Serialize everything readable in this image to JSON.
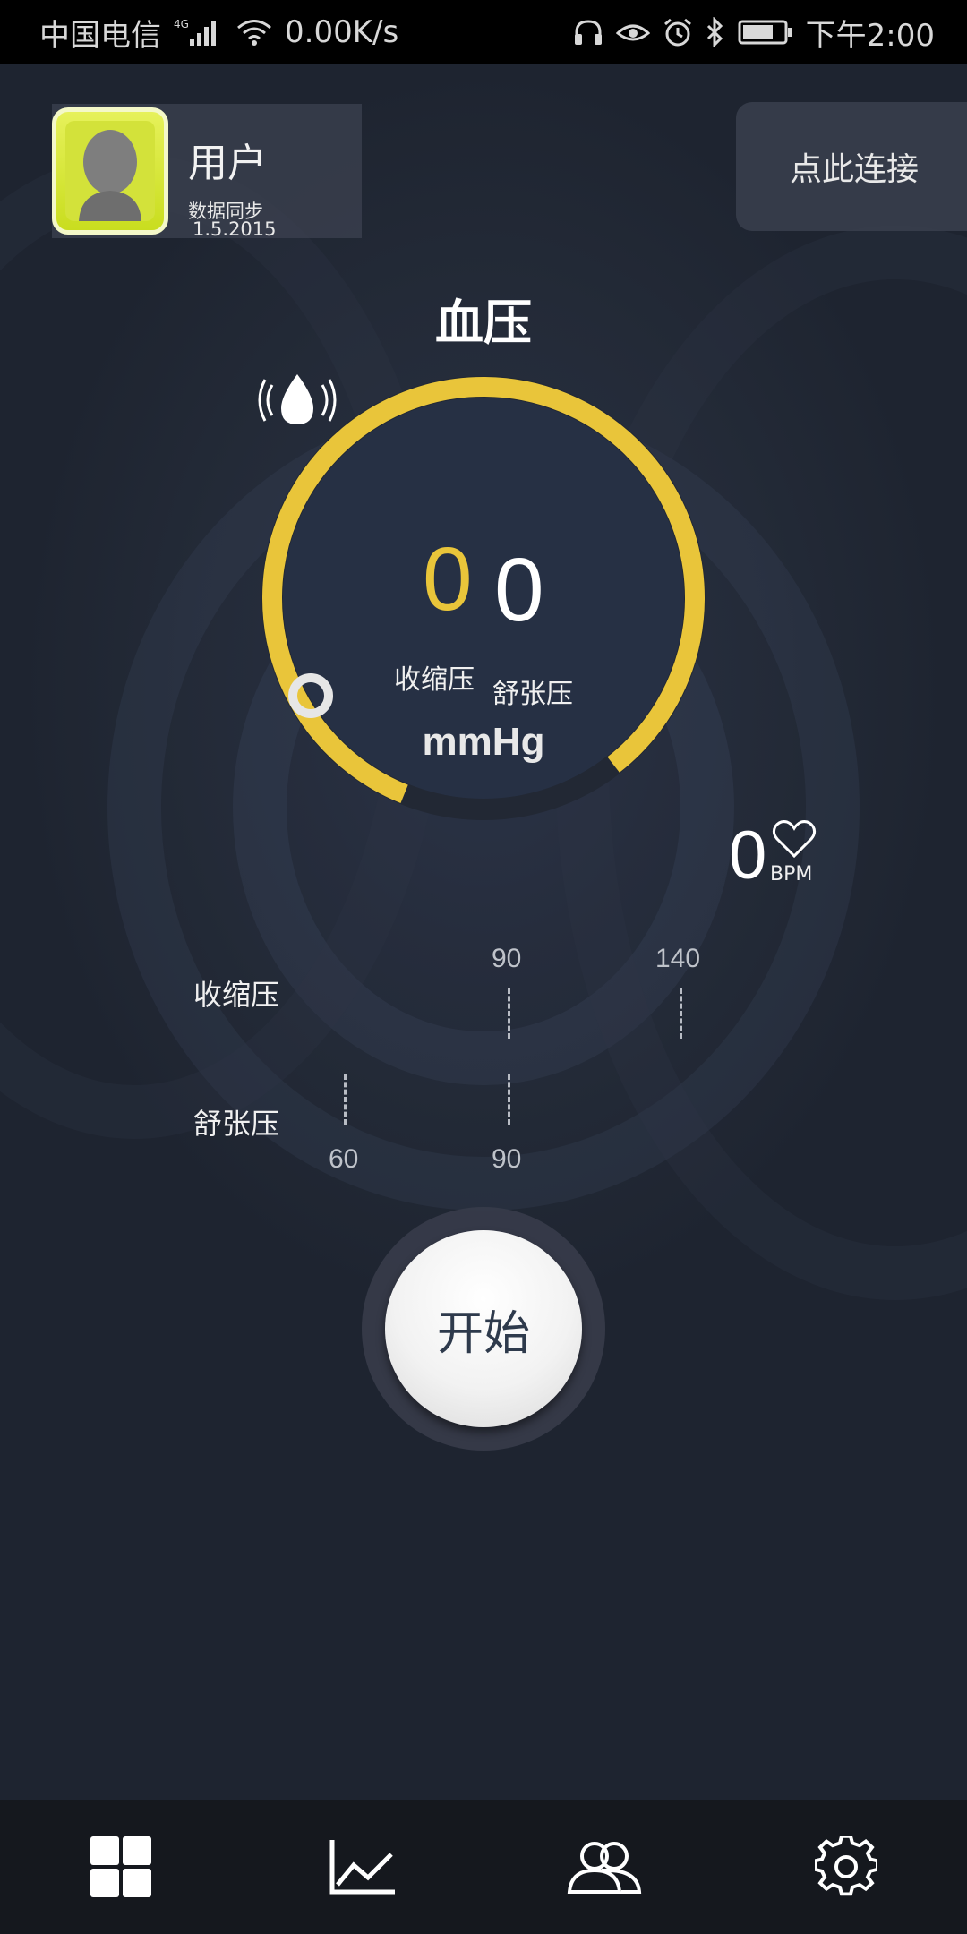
{
  "status_bar": {
    "carrier": "中国电信",
    "network": "4G",
    "speed": "0.00K/s",
    "battery_level": 0.75,
    "time": "下午2:00"
  },
  "user": {
    "name": "用户",
    "sync_label": "数据同步",
    "sync_date": "1.5.2015"
  },
  "connect_label": "点此连接",
  "title": "血压",
  "gauge": {
    "systolic_value": "0",
    "diastolic_value": "0",
    "systolic_label": "收缩压",
    "diastolic_label": "舒张压",
    "unit": "mmHg",
    "accent_color": "#e9c53a"
  },
  "heart_rate": {
    "value": "0",
    "unit": "BPM"
  },
  "scale": {
    "systolic_label": "收缩压",
    "diastolic_label": "舒张压",
    "systolic_ticks": [
      "90",
      "140"
    ],
    "diastolic_ticks": [
      "60",
      "90"
    ]
  },
  "start_label": "开始",
  "nav": [
    {
      "icon": "grid-icon"
    },
    {
      "icon": "chart-icon"
    },
    {
      "icon": "users-icon"
    },
    {
      "icon": "gear-icon"
    }
  ]
}
